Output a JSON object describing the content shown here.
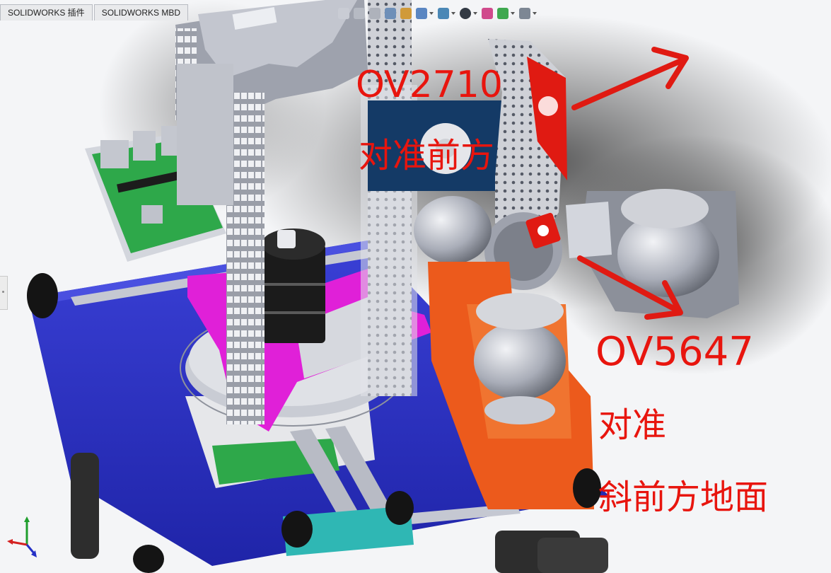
{
  "tabs": [
    {
      "label": "SOLIDWORKS 插件"
    },
    {
      "label": "SOLIDWORKS MBD"
    }
  ],
  "toolbar": {
    "icons": [
      "zoom-to-fit-icon",
      "zoom-area-icon",
      "previous-view-icon",
      "section-view-icon",
      "dynamic-annotation-icon",
      "view-orientation-icon",
      "display-style-icon",
      "hide-show-items-icon",
      "edit-appearance-icon",
      "apply-scene-icon",
      "view-settings-icon",
      "monitor-icon"
    ]
  },
  "annotations": {
    "camera1_model": "OV2710",
    "camera1_note": "对准前方",
    "camera2_model": "OV5647",
    "camera2_note_line1": "对准",
    "camera2_note_line2": "斜前方地面"
  },
  "colors": {
    "annotation": "#e8150e",
    "base_plate": "#2a2fc0",
    "bracket": "#e020d8",
    "mount": "#ec5a1c",
    "pcb": "#2ea84a",
    "steel": "#b9bcc6"
  }
}
